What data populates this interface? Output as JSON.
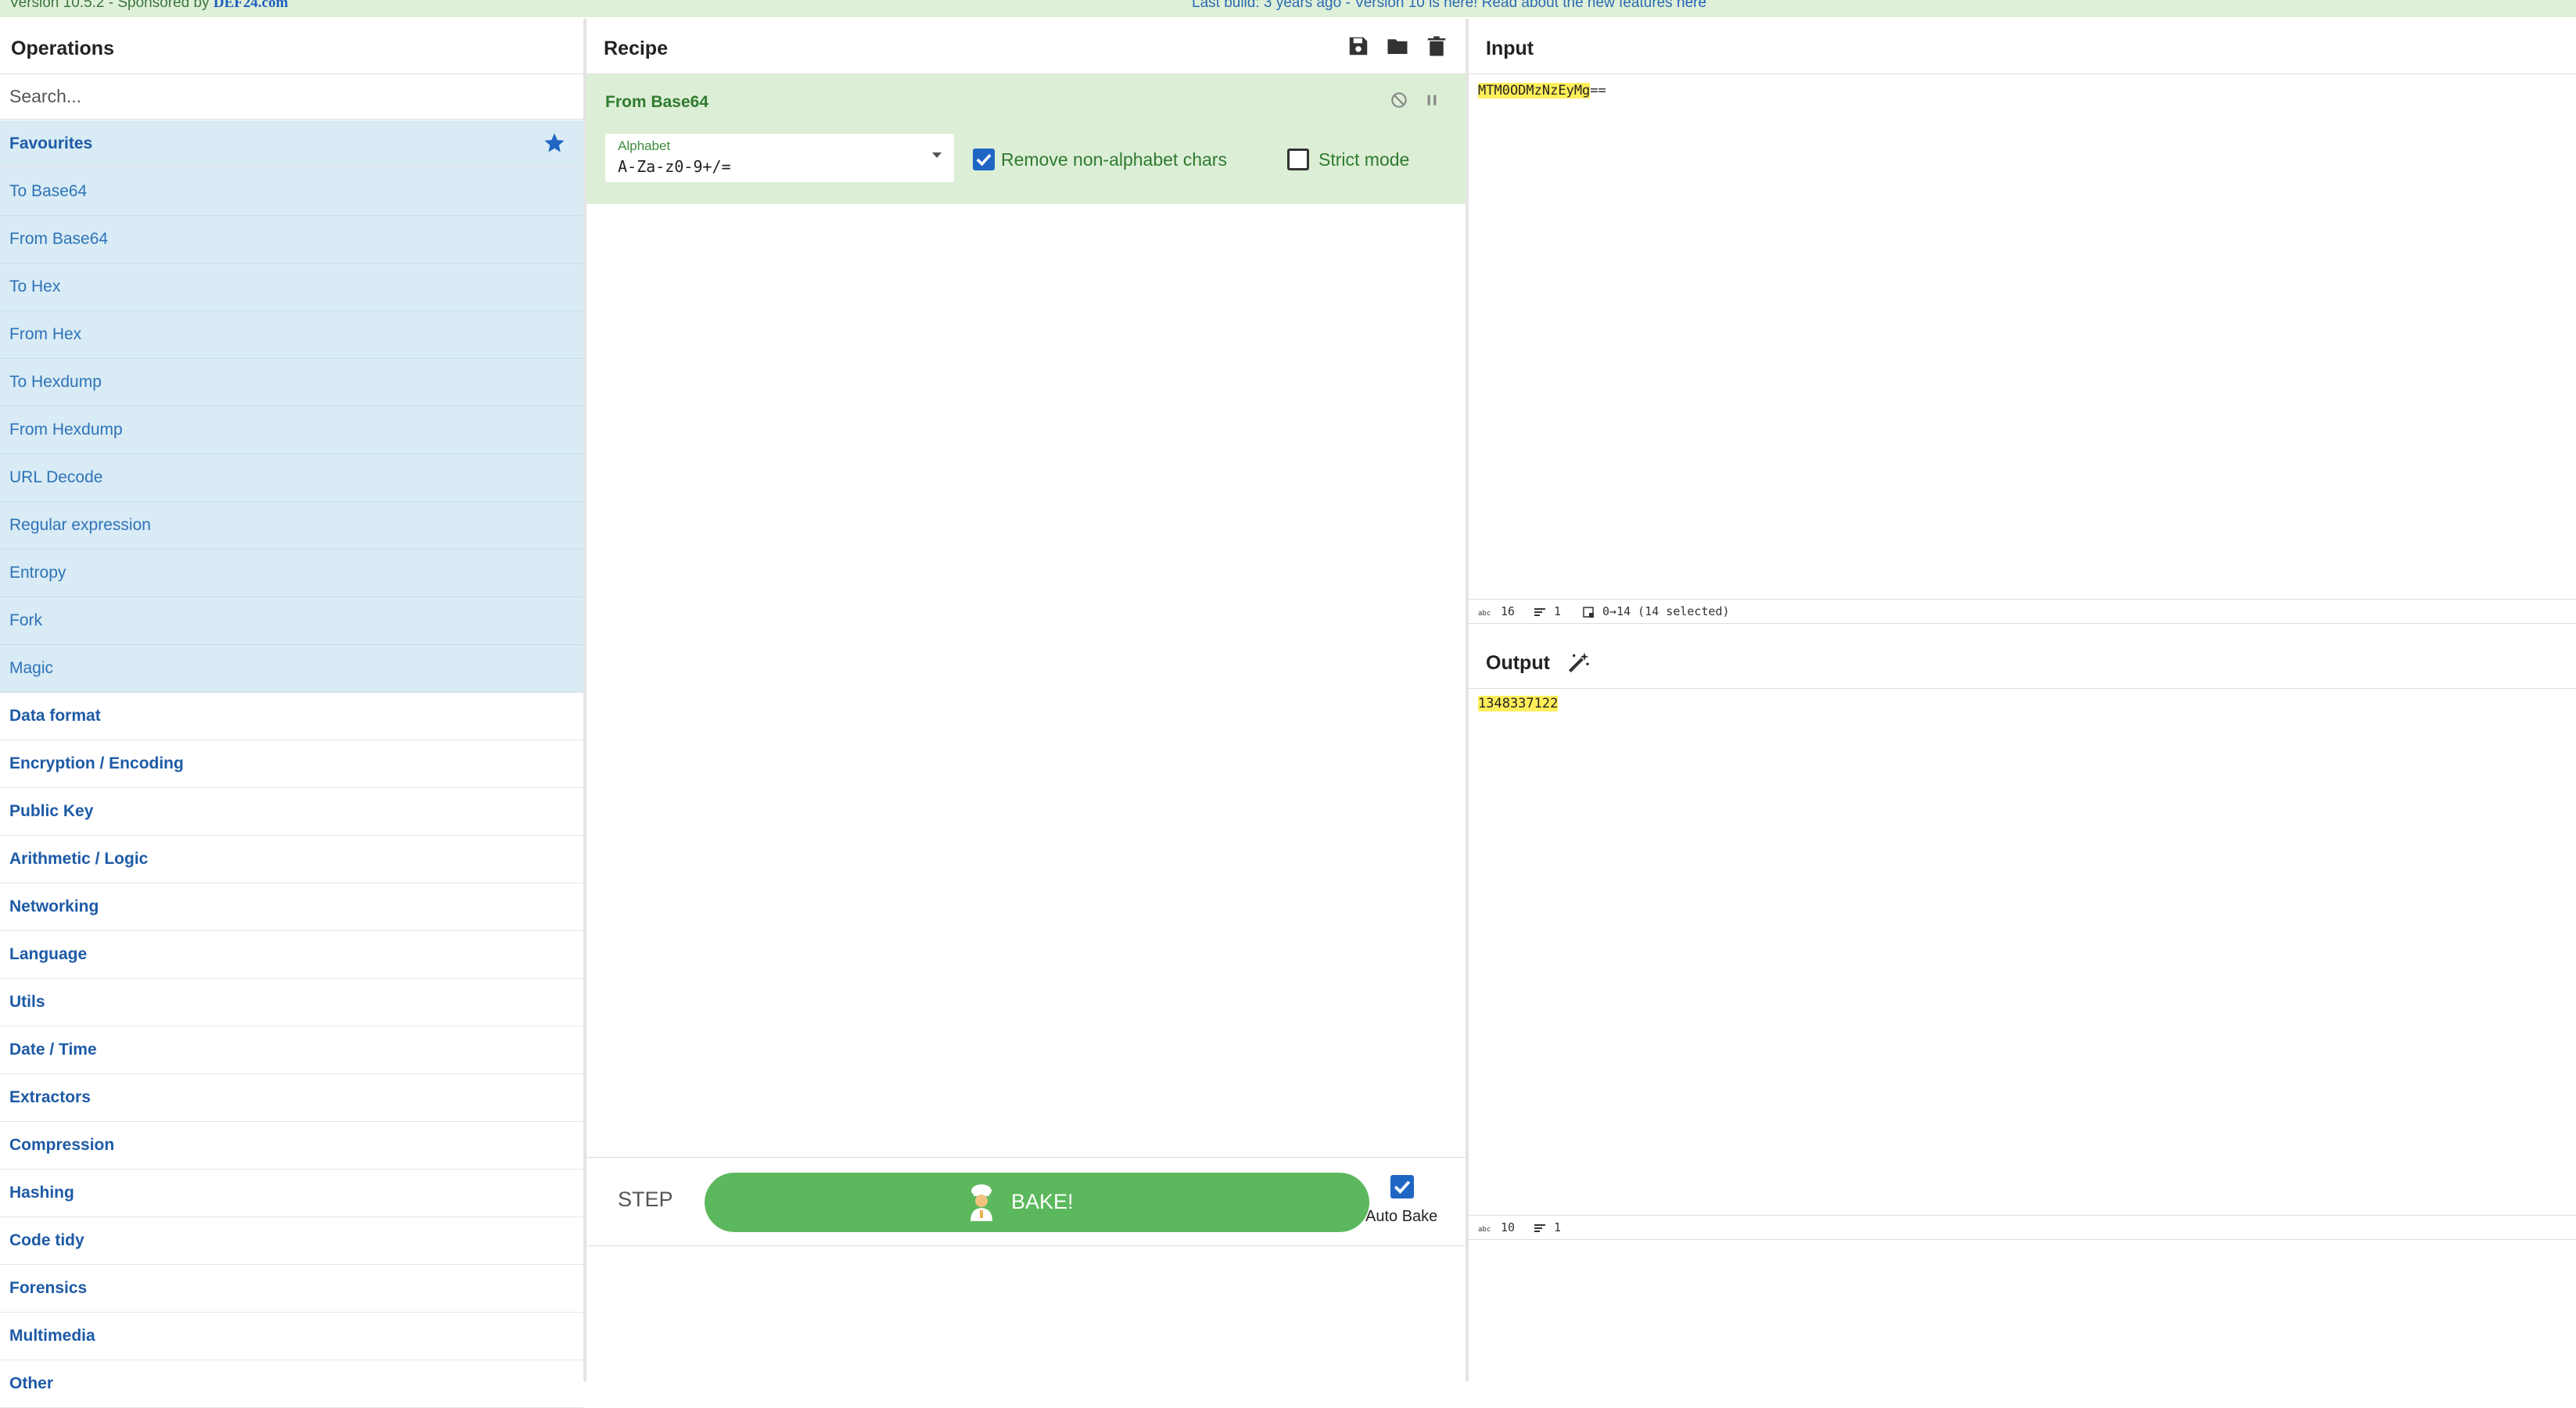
{
  "banner": {
    "version_text": "Version 10.5.2 - Sponsored by ",
    "sponsor": "DEF24.com",
    "build_text": "Last build: 3 years ago - Version 10 is here! Read about the new features ",
    "build_link": "here"
  },
  "operations": {
    "title": "Operations",
    "search_placeholder": "Search...",
    "favourites_label": "Favourites",
    "favourites": [
      "To Base64",
      "From Base64",
      "To Hex",
      "From Hex",
      "To Hexdump",
      "From Hexdump",
      "URL Decode",
      "Regular expression",
      "Entropy",
      "Fork",
      "Magic"
    ],
    "categories": [
      "Data format",
      "Encryption / Encoding",
      "Public Key",
      "Arithmetic / Logic",
      "Networking",
      "Language",
      "Utils",
      "Date / Time",
      "Extractors",
      "Compression",
      "Hashing",
      "Code tidy",
      "Forensics",
      "Multimedia",
      "Other"
    ]
  },
  "recipe": {
    "title": "Recipe",
    "operation": {
      "name": "From Base64",
      "alphabet_label": "Alphabet",
      "alphabet_value": "A-Za-z0-9+/=",
      "remove_nonalpha_label": "Remove non-alphabet chars",
      "remove_nonalpha_checked": true,
      "strict_label": "Strict mode",
      "strict_checked": false
    },
    "step_label": "STEP",
    "bake_label": "BAKE!",
    "autobake_label": "Auto Bake",
    "autobake_checked": true
  },
  "input": {
    "title": "Input",
    "text_highlighted": "MTM0ODMzNzEyMg",
    "text_rest": "==",
    "status": {
      "length": "16",
      "lines": "1",
      "selection": "0→14 (14 selected)"
    }
  },
  "output": {
    "title": "Output",
    "text": "1348337122",
    "status": {
      "length": "10",
      "lines": "1"
    }
  },
  "colors": {
    "favourites_bg": "#d9ebf5",
    "category_text": "#1d5aa6",
    "recipe_op_bg": "#dcefd6",
    "bake_green": "#5cb85c",
    "highlight": "#ffef5b"
  }
}
